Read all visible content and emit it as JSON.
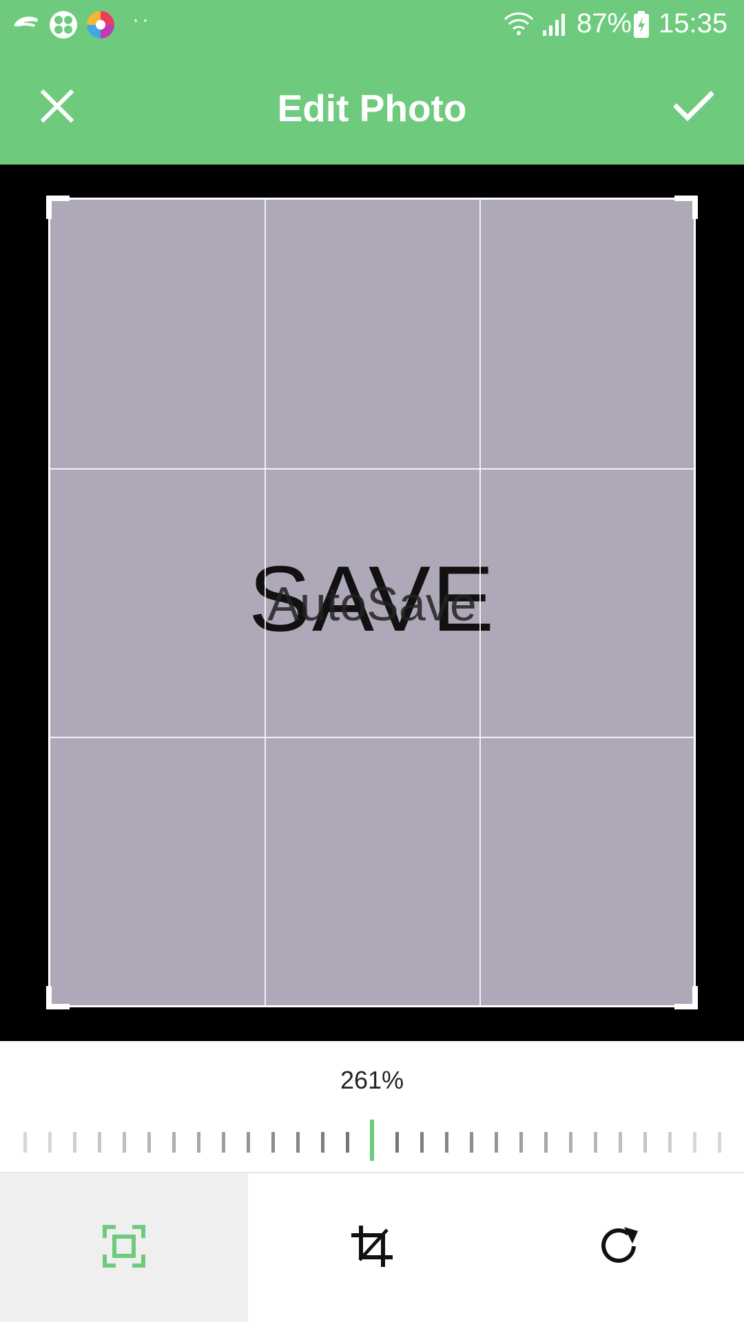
{
  "status_bar": {
    "icons": [
      "swirl-app-icon",
      "clover-app-icon",
      "color-wheel-app-icon"
    ],
    "overflow_dots": "··",
    "signal_icons": [
      "wifi-icon",
      "cell-signal-icon"
    ],
    "battery_percent": "87%",
    "battery_icon": "charging-battery-icon",
    "time": "15:35"
  },
  "app_bar": {
    "title": "Edit Photo",
    "close_icon": "close-icon",
    "confirm_icon": "check-icon"
  },
  "photo": {
    "main_text": "SAVE",
    "overlay_text": "AutoSave",
    "background_color": "#afa8b8"
  },
  "zoom": {
    "value": "261%"
  },
  "toolbar": {
    "tools": [
      {
        "name": "fit-frame-icon",
        "active": true
      },
      {
        "name": "crop-icon",
        "active": false
      },
      {
        "name": "rotate-icon",
        "active": false
      }
    ]
  },
  "colors": {
    "accent": "#6ecb7e",
    "canvas": "#000000"
  }
}
